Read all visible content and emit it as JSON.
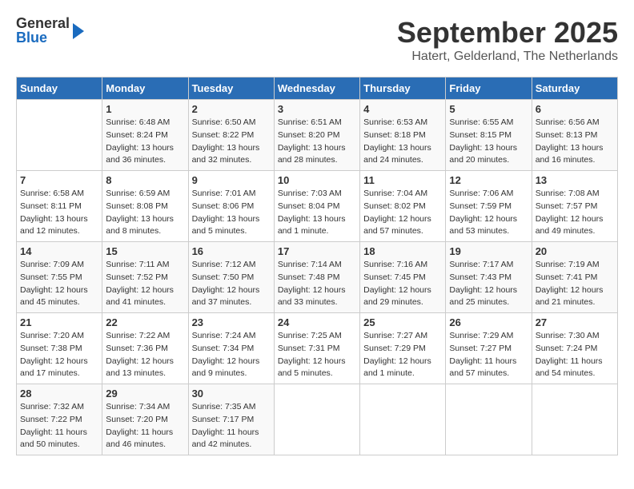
{
  "header": {
    "logo_general": "General",
    "logo_blue": "Blue",
    "title": "September 2025",
    "location": "Hatert, Gelderland, The Netherlands"
  },
  "days_of_week": [
    "Sunday",
    "Monday",
    "Tuesday",
    "Wednesday",
    "Thursday",
    "Friday",
    "Saturday"
  ],
  "weeks": [
    [
      {
        "day": "",
        "info": ""
      },
      {
        "day": "1",
        "info": "Sunrise: 6:48 AM\nSunset: 8:24 PM\nDaylight: 13 hours\nand 36 minutes."
      },
      {
        "day": "2",
        "info": "Sunrise: 6:50 AM\nSunset: 8:22 PM\nDaylight: 13 hours\nand 32 minutes."
      },
      {
        "day": "3",
        "info": "Sunrise: 6:51 AM\nSunset: 8:20 PM\nDaylight: 13 hours\nand 28 minutes."
      },
      {
        "day": "4",
        "info": "Sunrise: 6:53 AM\nSunset: 8:18 PM\nDaylight: 13 hours\nand 24 minutes."
      },
      {
        "day": "5",
        "info": "Sunrise: 6:55 AM\nSunset: 8:15 PM\nDaylight: 13 hours\nand 20 minutes."
      },
      {
        "day": "6",
        "info": "Sunrise: 6:56 AM\nSunset: 8:13 PM\nDaylight: 13 hours\nand 16 minutes."
      }
    ],
    [
      {
        "day": "7",
        "info": "Sunrise: 6:58 AM\nSunset: 8:11 PM\nDaylight: 13 hours\nand 12 minutes."
      },
      {
        "day": "8",
        "info": "Sunrise: 6:59 AM\nSunset: 8:08 PM\nDaylight: 13 hours\nand 8 minutes."
      },
      {
        "day": "9",
        "info": "Sunrise: 7:01 AM\nSunset: 8:06 PM\nDaylight: 13 hours\nand 5 minutes."
      },
      {
        "day": "10",
        "info": "Sunrise: 7:03 AM\nSunset: 8:04 PM\nDaylight: 13 hours\nand 1 minute."
      },
      {
        "day": "11",
        "info": "Sunrise: 7:04 AM\nSunset: 8:02 PM\nDaylight: 12 hours\nand 57 minutes."
      },
      {
        "day": "12",
        "info": "Sunrise: 7:06 AM\nSunset: 7:59 PM\nDaylight: 12 hours\nand 53 minutes."
      },
      {
        "day": "13",
        "info": "Sunrise: 7:08 AM\nSunset: 7:57 PM\nDaylight: 12 hours\nand 49 minutes."
      }
    ],
    [
      {
        "day": "14",
        "info": "Sunrise: 7:09 AM\nSunset: 7:55 PM\nDaylight: 12 hours\nand 45 minutes."
      },
      {
        "day": "15",
        "info": "Sunrise: 7:11 AM\nSunset: 7:52 PM\nDaylight: 12 hours\nand 41 minutes."
      },
      {
        "day": "16",
        "info": "Sunrise: 7:12 AM\nSunset: 7:50 PM\nDaylight: 12 hours\nand 37 minutes."
      },
      {
        "day": "17",
        "info": "Sunrise: 7:14 AM\nSunset: 7:48 PM\nDaylight: 12 hours\nand 33 minutes."
      },
      {
        "day": "18",
        "info": "Sunrise: 7:16 AM\nSunset: 7:45 PM\nDaylight: 12 hours\nand 29 minutes."
      },
      {
        "day": "19",
        "info": "Sunrise: 7:17 AM\nSunset: 7:43 PM\nDaylight: 12 hours\nand 25 minutes."
      },
      {
        "day": "20",
        "info": "Sunrise: 7:19 AM\nSunset: 7:41 PM\nDaylight: 12 hours\nand 21 minutes."
      }
    ],
    [
      {
        "day": "21",
        "info": "Sunrise: 7:20 AM\nSunset: 7:38 PM\nDaylight: 12 hours\nand 17 minutes."
      },
      {
        "day": "22",
        "info": "Sunrise: 7:22 AM\nSunset: 7:36 PM\nDaylight: 12 hours\nand 13 minutes."
      },
      {
        "day": "23",
        "info": "Sunrise: 7:24 AM\nSunset: 7:34 PM\nDaylight: 12 hours\nand 9 minutes."
      },
      {
        "day": "24",
        "info": "Sunrise: 7:25 AM\nSunset: 7:31 PM\nDaylight: 12 hours\nand 5 minutes."
      },
      {
        "day": "25",
        "info": "Sunrise: 7:27 AM\nSunset: 7:29 PM\nDaylight: 12 hours\nand 1 minute."
      },
      {
        "day": "26",
        "info": "Sunrise: 7:29 AM\nSunset: 7:27 PM\nDaylight: 11 hours\nand 57 minutes."
      },
      {
        "day": "27",
        "info": "Sunrise: 7:30 AM\nSunset: 7:24 PM\nDaylight: 11 hours\nand 54 minutes."
      }
    ],
    [
      {
        "day": "28",
        "info": "Sunrise: 7:32 AM\nSunset: 7:22 PM\nDaylight: 11 hours\nand 50 minutes."
      },
      {
        "day": "29",
        "info": "Sunrise: 7:34 AM\nSunset: 7:20 PM\nDaylight: 11 hours\nand 46 minutes."
      },
      {
        "day": "30",
        "info": "Sunrise: 7:35 AM\nSunset: 7:17 PM\nDaylight: 11 hours\nand 42 minutes."
      },
      {
        "day": "",
        "info": ""
      },
      {
        "day": "",
        "info": ""
      },
      {
        "day": "",
        "info": ""
      },
      {
        "day": "",
        "info": ""
      }
    ]
  ]
}
